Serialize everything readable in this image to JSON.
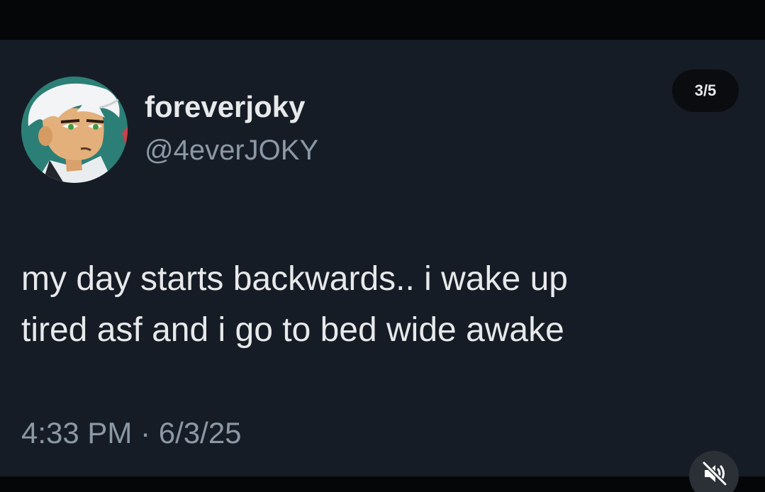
{
  "tweet": {
    "display_name": "foreverjoky",
    "handle": "@4everJOKY",
    "text_lines": [
      "my day starts backwards.. i wake up",
      "tired asf and i go to bed wide awake"
    ],
    "time": "4:33 PM",
    "separator": "·",
    "date": "6/3/25"
  },
  "carousel": {
    "counter": "3/5"
  },
  "controls": {
    "mute_icon": "speaker-muted-icon"
  },
  "colors": {
    "card_background": "#161c26",
    "frame_background": "#000000",
    "primary_text": "#e7e9ea",
    "secondary_text": "#8b98a5"
  }
}
